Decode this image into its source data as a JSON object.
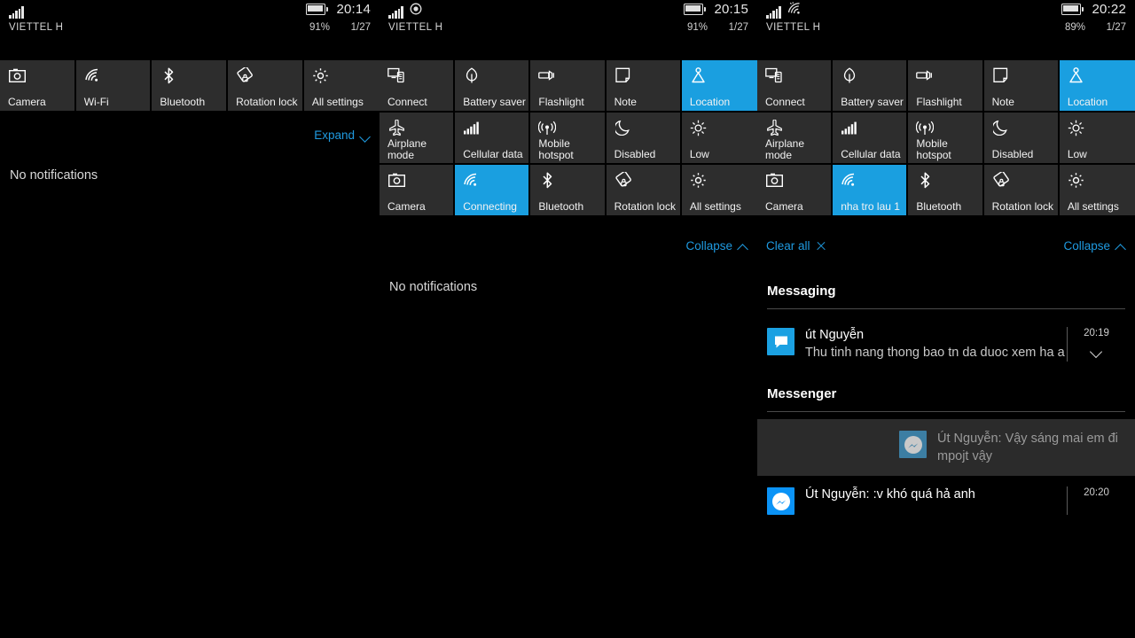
{
  "panels": [
    {
      "id": "panel-collapsed",
      "status": {
        "carrier": "VIETTEL H",
        "time": "20:14",
        "battery_percent": "91%",
        "date": "1/27",
        "icons": [
          "signal-bars-icon",
          "battery-icon"
        ]
      },
      "tiles": [
        {
          "label": "Camera",
          "icon": "camera-icon",
          "active": false
        },
        {
          "label": "Wi-Fi",
          "icon": "wifi-icon",
          "active": false
        },
        {
          "label": "Bluetooth",
          "icon": "bluetooth-icon",
          "active": false
        },
        {
          "label": "Rotation lock",
          "icon": "rotation-lock-icon",
          "active": false
        },
        {
          "label": "All settings",
          "icon": "gear-icon",
          "active": false
        }
      ],
      "action": {
        "right_label": "Expand",
        "right_icon": "chevron-down-icon"
      },
      "empty_text": "No notifications"
    },
    {
      "id": "panel-expanded-connecting",
      "status": {
        "carrier": "VIETTEL H",
        "time": "20:15",
        "battery_percent": "91%",
        "date": "1/27",
        "icons": [
          "signal-bars-icon",
          "location-active-icon",
          "battery-icon"
        ]
      },
      "tiles": [
        {
          "label": "Connect",
          "icon": "connect-icon",
          "active": false
        },
        {
          "label": "Battery saver",
          "icon": "battery-saver-icon",
          "active": false
        },
        {
          "label": "Flashlight",
          "icon": "flashlight-icon",
          "active": false
        },
        {
          "label": "Note",
          "icon": "note-icon",
          "active": false
        },
        {
          "label": "Location",
          "icon": "location-icon",
          "active": true
        },
        {
          "label": "Airplane\nmode",
          "icon": "airplane-icon",
          "active": false
        },
        {
          "label": "Cellular data",
          "icon": "cellular-data-icon",
          "active": false
        },
        {
          "label": "Mobile\nhotspot",
          "icon": "hotspot-icon",
          "active": false
        },
        {
          "label": "Disabled",
          "icon": "moon-icon",
          "active": false
        },
        {
          "label": "Low",
          "icon": "brightness-icon",
          "active": false
        },
        {
          "label": "Camera",
          "icon": "camera-icon",
          "active": false
        },
        {
          "label": "Connecting",
          "icon": "wifi-icon",
          "active": true
        },
        {
          "label": "Bluetooth",
          "icon": "bluetooth-icon",
          "active": false
        },
        {
          "label": "Rotation lock",
          "icon": "rotation-lock-icon",
          "active": false
        },
        {
          "label": "All settings",
          "icon": "gear-icon",
          "active": false
        }
      ],
      "action": {
        "right_label": "Collapse",
        "right_icon": "chevron-up-icon"
      },
      "empty_text": "No notifications"
    },
    {
      "id": "panel-expanded-notifications",
      "status": {
        "carrier": "VIETTEL H",
        "time": "20:22",
        "battery_percent": "89%",
        "date": "1/27",
        "icons": [
          "signal-bars-icon",
          "wifi-activity-icon",
          "battery-icon"
        ]
      },
      "tiles": [
        {
          "label": "Connect",
          "icon": "connect-icon",
          "active": false
        },
        {
          "label": "Battery saver",
          "icon": "battery-saver-icon",
          "active": false
        },
        {
          "label": "Flashlight",
          "icon": "flashlight-icon",
          "active": false
        },
        {
          "label": "Note",
          "icon": "note-icon",
          "active": false
        },
        {
          "label": "Location",
          "icon": "location-icon",
          "active": true
        },
        {
          "label": "Airplane\nmode",
          "icon": "airplane-icon",
          "active": false
        },
        {
          "label": "Cellular data",
          "icon": "cellular-data-icon",
          "active": false
        },
        {
          "label": "Mobile\nhotspot",
          "icon": "hotspot-icon",
          "active": false
        },
        {
          "label": "Disabled",
          "icon": "moon-icon",
          "active": false
        },
        {
          "label": "Low",
          "icon": "brightness-icon",
          "active": false
        },
        {
          "label": "Camera",
          "icon": "camera-icon",
          "active": false
        },
        {
          "label": "nha tro lau 1",
          "icon": "wifi-icon",
          "active": true
        },
        {
          "label": "Bluetooth",
          "icon": "bluetooth-icon",
          "active": false
        },
        {
          "label": "Rotation lock",
          "icon": "rotation-lock-icon",
          "active": false
        },
        {
          "label": "All settings",
          "icon": "gear-icon",
          "active": false
        }
      ],
      "action": {
        "left_label": "Clear all",
        "left_icon": "close-icon",
        "right_label": "Collapse",
        "right_icon": "chevron-up-icon"
      },
      "groups": [
        {
          "title": "Messaging",
          "items": [
            {
              "icon": "message-bubble-icon",
              "title": "út Nguyễn",
              "text": "Thu tinh nang thong bao tn da duoc xem ha a",
              "time": "20:19",
              "expandable": true,
              "swiped": false
            }
          ]
        },
        {
          "title": "Messenger",
          "items": [
            {
              "icon": "messenger-icon",
              "title": "",
              "text": "Út Nguyễn: Vậy sáng mai em đi mpojt vậy",
              "time": "",
              "expandable": false,
              "swiped": true
            },
            {
              "icon": "messenger-icon",
              "title": "Út Nguyễn: :v khó quá hả anh",
              "text": "",
              "time": "20:20",
              "expandable": false,
              "swiped": false
            }
          ]
        }
      ]
    }
  ],
  "colors": {
    "accent": "#1a9fe0",
    "link": "#1f9ae0",
    "tile_bg": "#2d2d2d",
    "background": "#000000",
    "swipe_bg": "#2b2b2b"
  }
}
